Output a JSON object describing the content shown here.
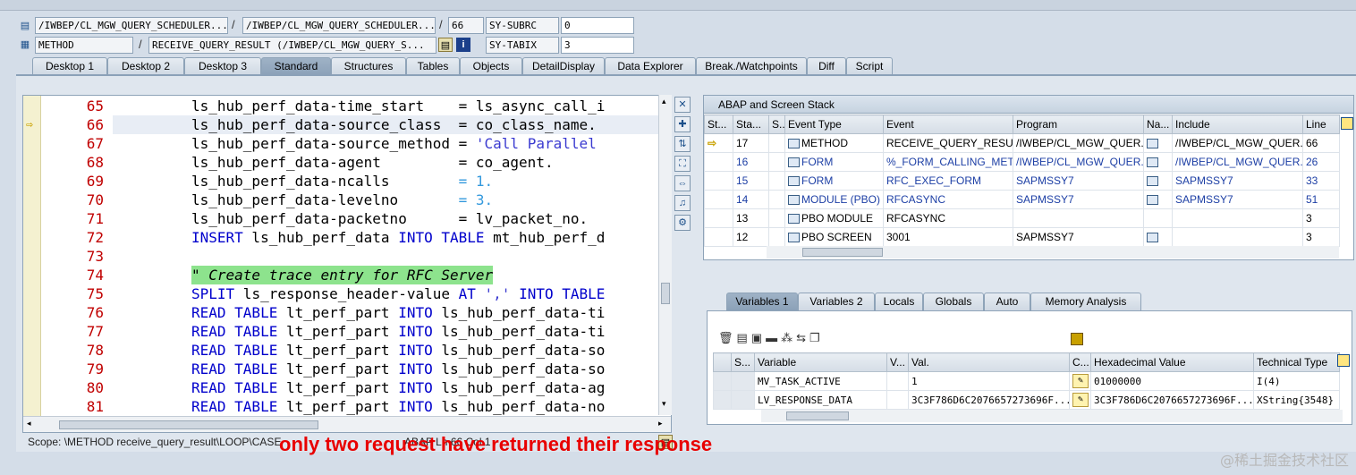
{
  "header": {
    "row1": {
      "field1": "/IWBEP/CL_MGW_QUERY_SCHEDULER...",
      "field2": "/IWBEP/CL_MGW_QUERY_SCHEDULER...",
      "field3": "66",
      "sysfield": "SY-SUBRC",
      "sysvalue": "0"
    },
    "row2": {
      "field1": "METHOD",
      "field2": "RECEIVE_QUERY_RESULT (/IWBEP/CL_MGW_QUERY_S...",
      "sysfield": "SY-TABIX",
      "sysvalue": "3"
    }
  },
  "tabs": [
    "Desktop 1",
    "Desktop 2",
    "Desktop 3",
    "Standard",
    "Structures",
    "Tables",
    "Objects",
    "DetailDisplay",
    "Data Explorer",
    "Break./Watchpoints",
    "Diff",
    "Script"
  ],
  "editor": {
    "lines": [
      {
        "n": "65"
      },
      {
        "n": "66"
      },
      {
        "n": "67"
      },
      {
        "n": "68"
      },
      {
        "n": "69"
      },
      {
        "n": "70"
      },
      {
        "n": "71"
      },
      {
        "n": "72"
      },
      {
        "n": "73"
      },
      {
        "n": "74"
      },
      {
        "n": "75"
      },
      {
        "n": "76"
      },
      {
        "n": "77"
      },
      {
        "n": "78"
      },
      {
        "n": "79"
      },
      {
        "n": "80"
      },
      {
        "n": "81"
      }
    ],
    "scope": "Scope: \\METHOD receive_query_result\\LOOP\\CASE",
    "abap_info": "ABAP    Ln  66 Col  1"
  },
  "caption": "only two request have returned their response",
  "watermark": "@稀土掘金技术社区",
  "stack": {
    "title": "ABAP and Screen Stack",
    "columns": [
      "St...",
      "Sta...",
      "S...",
      "Event Type",
      "Event",
      "Program",
      "Na...",
      "Include",
      "Line"
    ],
    "rows": [
      {
        "sta": "17",
        "type": "METHOD",
        "event": "RECEIVE_QUERY_RESULT",
        "program": "/IWBEP/CL_MGW_QUER...",
        "include": "/IWBEP/CL_MGW_QUER...",
        "line": "66",
        "current": true,
        "link": false
      },
      {
        "sta": "16",
        "type": "FORM",
        "event": "%_FORM_CALLING_MET...",
        "program": "/IWBEP/CL_MGW_QUER...",
        "include": "/IWBEP/CL_MGW_QUER...",
        "line": "26",
        "current": false,
        "link": true
      },
      {
        "sta": "15",
        "type": "FORM",
        "event": "RFC_EXEC_FORM",
        "program": "SAPMSSY7",
        "include": "SAPMSSY7",
        "line": "33",
        "current": false,
        "link": true
      },
      {
        "sta": "14",
        "type": "MODULE (PBO)",
        "event": "RFCASYNC",
        "program": "SAPMSSY7",
        "include": "SAPMSSY7",
        "line": "51",
        "current": false,
        "link": true
      },
      {
        "sta": "13",
        "type": "PBO MODULE",
        "event": "RFCASYNC",
        "program": "",
        "include": "",
        "line": "3",
        "current": false,
        "link": false
      },
      {
        "sta": "12",
        "type": "PBO SCREEN",
        "event": "3001",
        "program": "SAPMSSY7",
        "include": "",
        "line": "3",
        "current": false,
        "link": false
      }
    ]
  },
  "vartabs": [
    "Variables 1",
    "Variables 2",
    "Locals",
    "Globals",
    "Auto",
    "Memory Analysis"
  ],
  "variables": {
    "columns": [
      "S...",
      "Variable",
      "V...",
      "Val.",
      "C...",
      "Hexadecimal Value",
      "Technical Type"
    ],
    "rows": [
      {
        "name": "MV_TASK_ACTIVE",
        "val": "1",
        "hex": "01000000",
        "type": "I(4)"
      },
      {
        "name": "LV_RESPONSE_DATA",
        "val": "3C3F786D6C2076657273696F...",
        "hex": "3C3F786D6C2076657273696F...",
        "type": "XString{3548}"
      }
    ]
  }
}
